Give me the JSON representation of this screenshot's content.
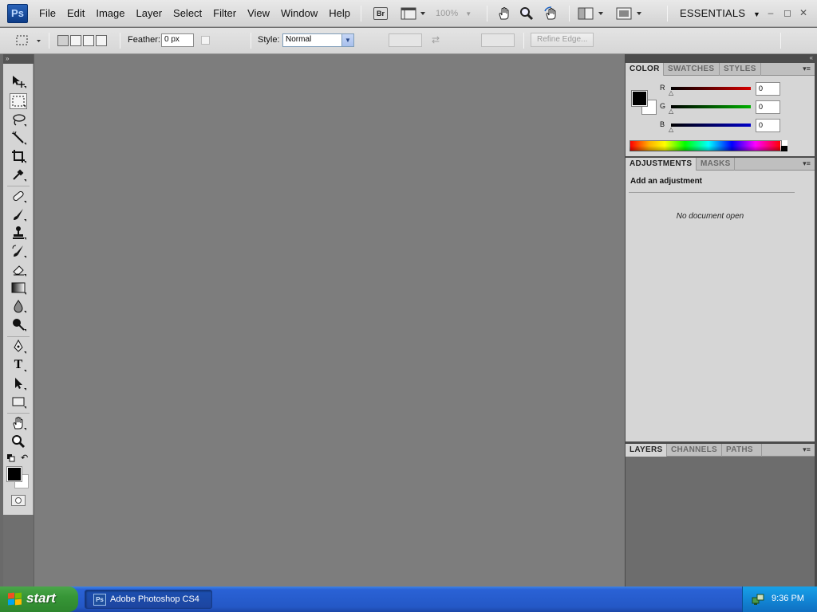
{
  "app": {
    "logo_text": "Ps",
    "menu": [
      "File",
      "Edit",
      "Image",
      "Layer",
      "Select",
      "Filter",
      "View",
      "Window",
      "Help"
    ],
    "bridge_label": "Br",
    "zoom_level": "100%",
    "workspace": "ESSENTIALS",
    "window_controls": {
      "minimize": "–",
      "restore": "◻",
      "close": "✕"
    }
  },
  "options_bar": {
    "feather_label": "Feather:",
    "feather_value": "0 px",
    "style_label": "Style:",
    "style_value": "Normal",
    "refine_edge_label": "Refine Edge..."
  },
  "tools": {
    "header": "»",
    "items": [
      "move",
      "rectangular-marquee",
      "lasso",
      "quick-selection",
      "crop",
      "eyedropper",
      "spot-healing-brush",
      "brush",
      "clone-stamp",
      "history-brush",
      "eraser",
      "gradient",
      "blur",
      "dodge",
      "pen",
      "type",
      "path-selection",
      "rectangle",
      "hand",
      "zoom"
    ],
    "type_label": "T",
    "foreground_color": "#000000",
    "background_color": "#ffffff"
  },
  "panels": {
    "color": {
      "tabs": [
        "COLOR",
        "SWATCHES",
        "STYLES"
      ],
      "channels": [
        {
          "label": "R",
          "value": "0",
          "color": "#d60000"
        },
        {
          "label": "G",
          "value": "0",
          "color": "#00b000"
        },
        {
          "label": "B",
          "value": "0",
          "color": "#0000c8"
        }
      ]
    },
    "adjustments": {
      "tabs": [
        "ADJUSTMENTS",
        "MASKS"
      ],
      "title": "Add an adjustment",
      "empty_message": "No document open"
    },
    "layers": {
      "tabs": [
        "LAYERS",
        "CHANNELS",
        "PATHS"
      ]
    }
  },
  "taskbar": {
    "start_label": "start",
    "task_label": "Adobe Photoshop CS4",
    "task_icon": "Ps",
    "clock": "9:36 PM"
  },
  "colors": {
    "canvas": "#7d7d7d",
    "taskbar": "#2458c6",
    "start": "#379637"
  }
}
